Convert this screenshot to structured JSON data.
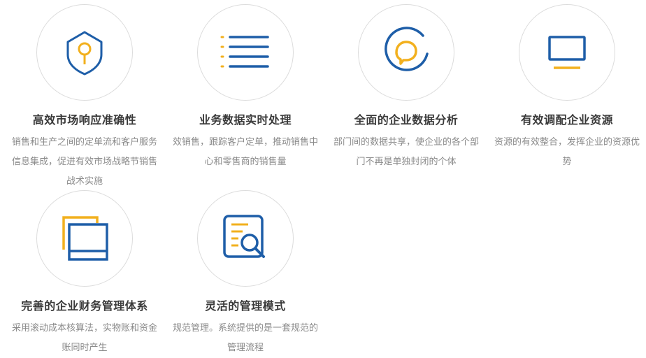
{
  "colors": {
    "blue": "#1e5ea8",
    "yellow": "#f2b01e",
    "circle_border": "#dcdcdc",
    "title": "#3a3a3a",
    "desc": "#8a8a8a"
  },
  "features": [
    {
      "icon": "shield-key-icon",
      "title": "高效市场响应准确性",
      "desc": "销售和生产之间的定单流和客户服务信息集成，促进有效市场战略节销售战术实施"
    },
    {
      "icon": "list-icon",
      "title": "业务数据实时处理",
      "desc": "效销售，跟踪客户定单，推动销售中心和零售商的销售量"
    },
    {
      "icon": "chat-bubble-icon",
      "title": "全面的企业数据分析",
      "desc": "部门间的数据共享，使企业的各个部门不再是单独封闭的个体"
    },
    {
      "icon": "monitor-icon",
      "title": "有效调配企业资源",
      "desc": "资源的有效整合，发挥企业的资源优势"
    },
    {
      "icon": "stacked-windows-icon",
      "title": "完善的企业财务管理体系",
      "desc": "采用滚动成本核算法，实物账和资金账同时产生"
    },
    {
      "icon": "document-search-icon",
      "title": "灵活的管理模式",
      "desc": "规范管理。系统提供的是一套规范的管理流程"
    }
  ]
}
